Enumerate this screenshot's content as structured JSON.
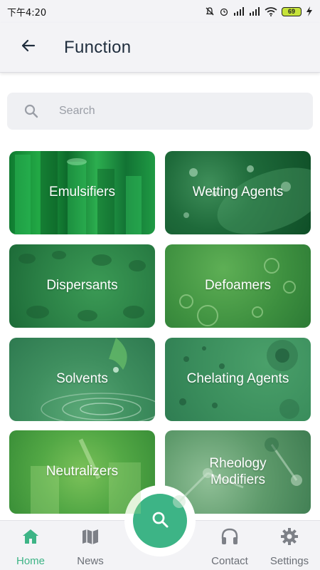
{
  "status_bar": {
    "time": "下午4:20",
    "battery": "69"
  },
  "app_bar": {
    "title": "Function"
  },
  "search": {
    "placeholder": "Search"
  },
  "categories": [
    {
      "label": "Emulsifiers"
    },
    {
      "label": "Wetting Agents"
    },
    {
      "label": "Dispersants"
    },
    {
      "label": "Defoamers"
    },
    {
      "label": "Solvents"
    },
    {
      "label": "Chelating Agents"
    },
    {
      "label": "Neutralizers"
    },
    {
      "label": "Rheology\nModifiers"
    }
  ],
  "bottom_nav": {
    "items": [
      {
        "label": "Home",
        "icon": "home-icon",
        "active": true
      },
      {
        "label": "News",
        "icon": "map-icon",
        "active": false
      },
      {
        "label": "Contact",
        "icon": "headphones-icon",
        "active": false
      },
      {
        "label": "Settings",
        "icon": "gear-icon",
        "active": false
      }
    ],
    "fab_icon": "search-icon"
  },
  "colors": {
    "accent": "#3db486",
    "title": "#1f2d3d",
    "inactive": "#6b6f76"
  }
}
